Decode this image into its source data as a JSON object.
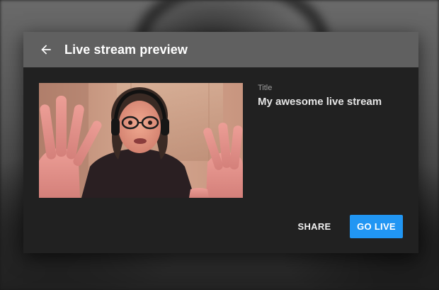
{
  "dialog": {
    "title": "Live stream preview",
    "back_icon": "arrow-back-icon"
  },
  "stream": {
    "title_label": "Title",
    "title_value": "My awesome live stream",
    "preview_image": "webcam preview"
  },
  "actions": {
    "share_label": "SHARE",
    "go_live_label": "GO LIVE"
  },
  "colors": {
    "header": "#606060",
    "dialog_bg": "#212121",
    "accent": "#2196f3"
  }
}
